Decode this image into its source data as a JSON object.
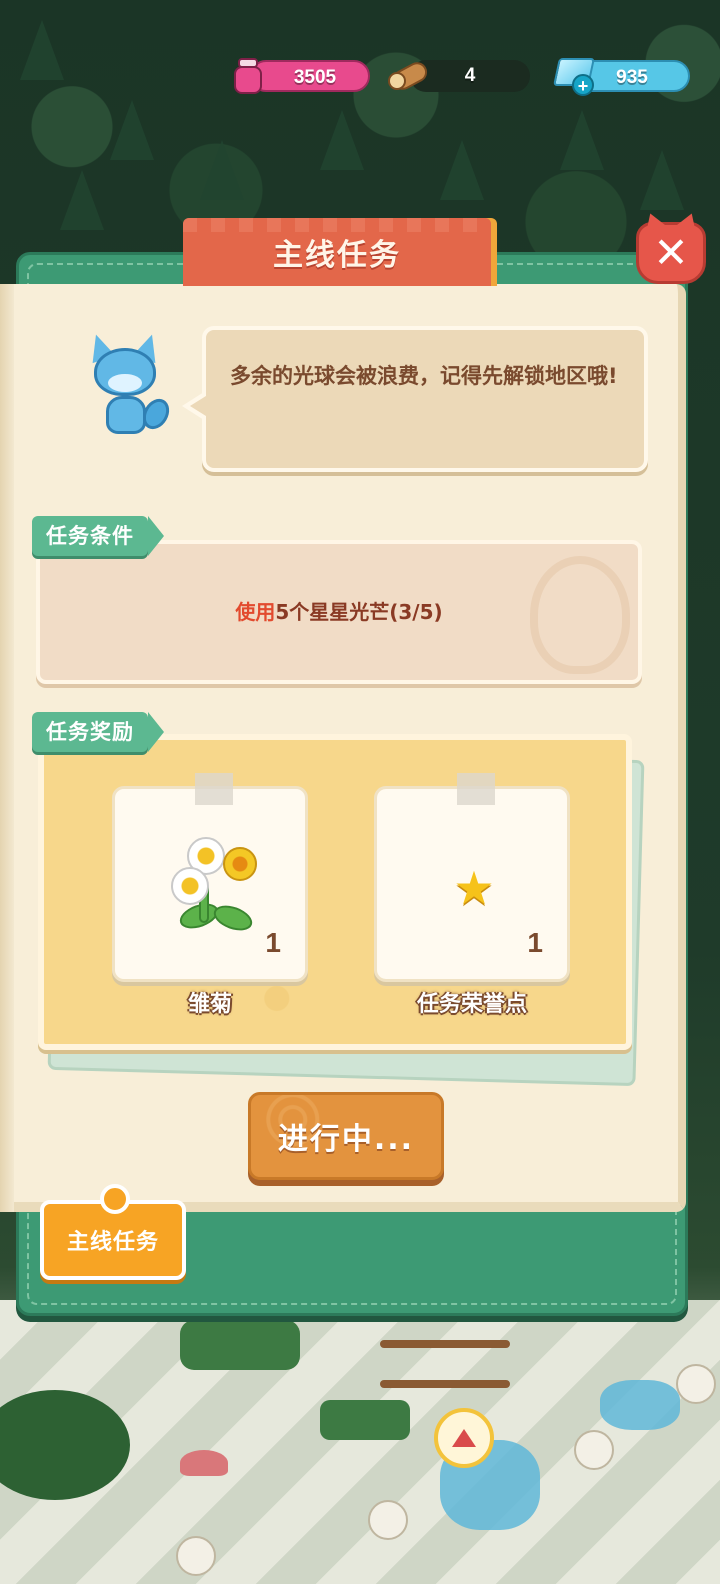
{
  "resources": {
    "potion": "3505",
    "wood": "4",
    "gems": "935"
  },
  "panel": {
    "title": "主线任务",
    "close_label": "✕"
  },
  "dialogue": {
    "text": "多余的光球会被浪费，记得先解锁地区哦!"
  },
  "condition": {
    "label": "任务条件",
    "highlight": "使用",
    "text": "5个星星光芒(3/5)"
  },
  "rewards": {
    "label": "任务奖励",
    "items": [
      {
        "name": "雏菊",
        "count": "1",
        "icon": "daisy-icon"
      },
      {
        "name": "任务荣誉点",
        "count": "1",
        "icon": "star-icon"
      }
    ]
  },
  "progress_button": {
    "label": "进行中..."
  },
  "bottom_tab": {
    "label": "主线任务"
  },
  "colors": {
    "frame": "#3d9a74",
    "title_tab": "#e3674a",
    "close": "#e6564a",
    "progress": "#e3933e",
    "tab": "#f7a424",
    "highlight_text": "#e24a2e"
  }
}
